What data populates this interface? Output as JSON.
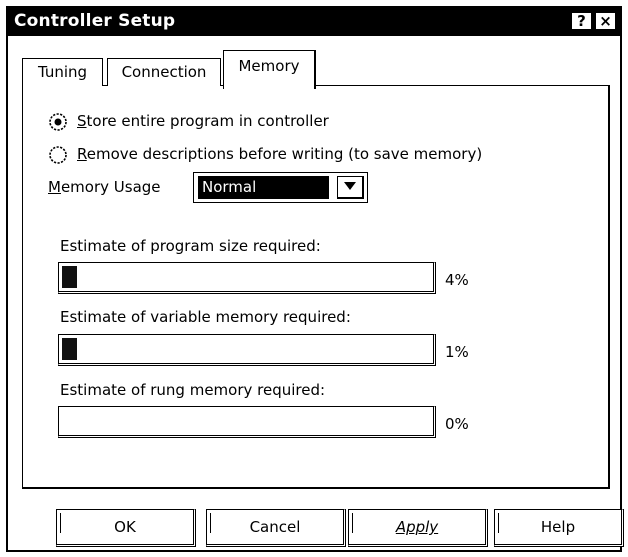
{
  "window": {
    "title": "Controller Setup",
    "help_button": "?",
    "close_button": "×"
  },
  "tabs": [
    {
      "label": "Tuning",
      "active": false
    },
    {
      "label": "Connection",
      "active": false
    },
    {
      "label": "Memory",
      "active": true
    }
  ],
  "storage": {
    "options": [
      {
        "mnemonic": "S",
        "rest": "tore entire program in controller",
        "selected": true
      },
      {
        "mnemonic": "R",
        "rest": "emove descriptions before writing (to save memory)",
        "selected": false
      }
    ]
  },
  "memory_usage": {
    "label_mnemonic": "M",
    "label_rest": "emory Usage",
    "selected_value": "Normal"
  },
  "estimates": [
    {
      "label": "Estimate of program size required:",
      "percent_text": "4%",
      "fill_fraction": 0.04
    },
    {
      "label": "Estimate of variable memory required:",
      "percent_text": "1%",
      "fill_fraction": 0.04
    },
    {
      "label": "Estimate of rung memory required:",
      "percent_text": "0%",
      "fill_fraction": 0.0
    }
  ],
  "buttons": {
    "ok": "OK",
    "cancel": "Cancel",
    "apply": "Apply",
    "help": "Help"
  },
  "colors": {
    "background": "#ffffff",
    "foreground": "#000000",
    "titlebar": "#000000",
    "selection": "#000000"
  }
}
